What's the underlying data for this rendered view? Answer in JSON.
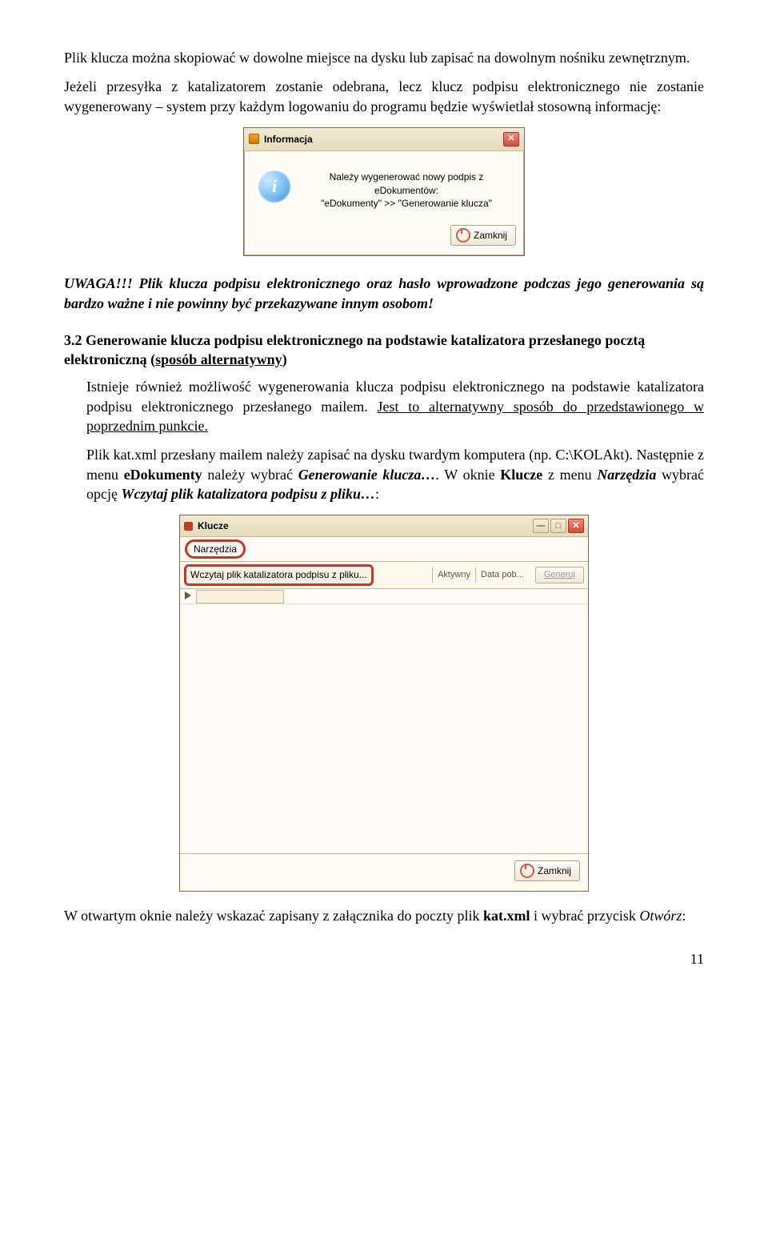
{
  "para1": "Plik klucza można skopiować w dowolne miejsce na dysku lub zapisać na dowolnym nośniku zewnętrznym.",
  "para2": "Jeżeli przesyłka z katalizatorem zostanie odebrana, lecz klucz podpisu elektronicznego nie zostanie wygenerowany – system przy każdym logowaniu do programu będzie wyświetlał stosowną informację:",
  "dlg1": {
    "title": "Informacja",
    "msg_l1": "Należy wygenerować nowy podpis z",
    "msg_l2": "eDokumentów:",
    "msg_l3": "\"eDokumenty\" >> \"Generowanie klucza\"",
    "close_btn": "Zamknij"
  },
  "warning": "UWAGA!!! Plik klucza podpisu elektronicznego oraz hasło wprowadzone podczas jego generowania są bardzo ważne i nie powinny być przekazywane innym osobom!",
  "section": {
    "num": "3.2 ",
    "title_a": "Generowanie klucza podpisu elektronicznego na podstawie katalizatora przesłanego pocztą elektroniczną (",
    "title_u": "sposób alternatywny",
    "title_b": ")"
  },
  "body2_a": "Istnieje również możliwość wygenerowania klucza podpisu elektronicznego na podstawie katalizatora podpisu elektronicznego przesłanego mailem. ",
  "body2_u": "Jest to alternatywny sposób do przedstawionego w poprzednim punkcie.",
  "body3": "Plik kat.xml przesłany mailem należy zapisać na dysku twardym komputera (np. C:\\KOLAkt). Następnie z menu ",
  "body3_b1": "eDokumenty",
  "body3_c": " należy wybrać ",
  "body3_i1": "Generowanie klucza…",
  "body3_d": ". W oknie ",
  "body3_b2": "Klucze",
  "body3_e": " z menu ",
  "body3_i2": "Narzędzia",
  "body3_f": " wybrać opcję ",
  "body3_i3": "Wczytaj plik katalizatora podpisu z pliku…",
  "body3_g": ":",
  "dlg2": {
    "title": "Klucze",
    "menu": "Narzędzia",
    "menuitem": "Wczytaj plik katalizatora podpisu z pliku...",
    "col1": "Aktywny",
    "col2": "Data pob...",
    "gen": "Generuj",
    "close_btn": "Zamknij"
  },
  "para_last_a": "W otwartym oknie należy wskazać zapisany z załącznika do poczty plik ",
  "para_last_b": "kat.xml",
  "para_last_c": " i wybrać przycisk ",
  "para_last_d": "Otwórz",
  "para_last_e": ":",
  "page_number": "11"
}
